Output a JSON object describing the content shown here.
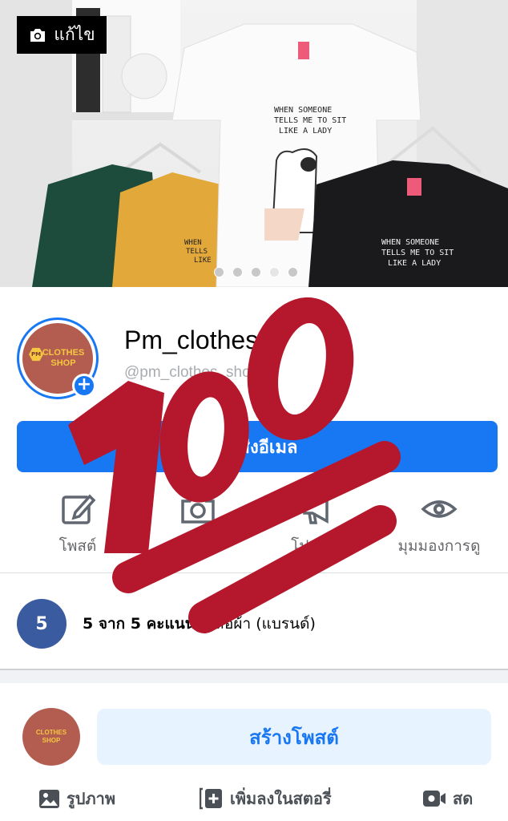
{
  "cover": {
    "edit_label": "แก้ไข",
    "slides": 5,
    "active_slide": 4,
    "shirt_text": [
      "WHEN SOMEONE",
      "TELLS ME TO SIT",
      "LIKE A LADY"
    ]
  },
  "profile": {
    "name": "Pm_clothes_shop",
    "handle": "@pm_clothes_shop",
    "logo_top": "CLOTHES",
    "logo_bottom": "SHOP",
    "logo_badge": "PM"
  },
  "email_button": {
    "label": "ส่งอีเมล"
  },
  "actions": [
    {
      "label": "โพสต์",
      "icon": "edit-icon"
    },
    {
      "label": "",
      "icon": "camera-icon"
    },
    {
      "label": "โปรโมท",
      "icon": "megaphone-icon"
    },
    {
      "label": "มุมมองการดู",
      "icon": "eye-icon"
    }
  ],
  "rating": {
    "badge": "5",
    "score_text": "5 จาก 5 คะแนน",
    "category": " · เสื้อผ้า (แบรนด์)"
  },
  "composer": {
    "create_label": "สร้างโพสต์"
  },
  "bottom_bar": {
    "photo": "รูปภาพ",
    "story": "เพิ่มลงในสตอรี่",
    "live": "สด"
  },
  "overlay": {
    "text": "100",
    "color": "#b5172c"
  },
  "colors": {
    "accent": "#1877f2",
    "rating_badge": "#3a5ba0",
    "avatar_bg": "#b25d4f",
    "logo_yellow": "#f5c640"
  }
}
